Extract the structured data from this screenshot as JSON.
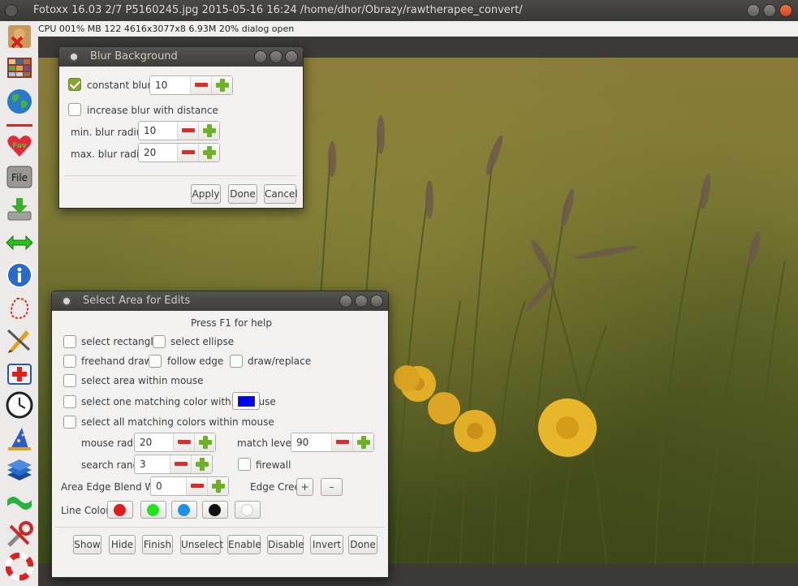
{
  "window": {
    "title": "Fotoxx 16.03  2/7  P5160245.jpg  2015-05-16 16:24  /home/dhor/Obrazy/rawtherapee_convert/"
  },
  "status": {
    "text": "CPU 001%  MB 122  4616x3077x8  6.93M  20%  dialog open"
  },
  "toolbar": {
    "file_label": "File",
    "fav_label": "Fav",
    "items": [
      "prev-next-image-icon",
      "thumbnail-gallery-icon",
      "globe-map-icon",
      "favorites-icon",
      "file-menu-icon",
      "save-icon",
      "zoom-icon",
      "info-icon",
      "select-area-icon",
      "edit-tools-icon",
      "repair-icon",
      "clock-icon",
      "art-effects-icon",
      "layers-icon",
      "warp-icon",
      "tools-icon",
      "help-icon"
    ]
  },
  "blur_dialog": {
    "title": "Blur Background",
    "constant_blur_label": "constant blur",
    "constant_blur_checked": true,
    "constant_blur_value": "10",
    "increase_label": "increase blur with distance",
    "increase_checked": false,
    "min_radius_label": "min. blur radius",
    "min_radius_value": "10",
    "max_radius_label": "max. blur radius",
    "max_radius_value": "20",
    "apply_label": "Apply",
    "done_label": "Done",
    "cancel_label": "Cancel"
  },
  "select_dialog": {
    "title": "Select Area for Edits",
    "help_text": "Press F1 for help",
    "select_rectangle": "select rectangle",
    "select_ellipse": "select ellipse",
    "freehand_draw": "freehand draw",
    "follow_edge": "follow edge",
    "draw_replace": "draw/replace",
    "select_within_mouse": "select area within mouse",
    "select_one_color": "select one matching color within mouse",
    "select_all_colors": "select all matching colors within mouse",
    "match_color": "#0000ff",
    "mouse_radius_label": "mouse radius",
    "mouse_radius_value": "20",
    "match_level_label": "match level %",
    "match_level_value": "90",
    "search_range_label": "search range",
    "search_range_value": "3",
    "firewall_label": "firewall",
    "edge_blend_label": "Area Edge Blend Width",
    "edge_blend_value": "0",
    "edge_creep_label": "Edge Creep",
    "edge_creep_plus": "+",
    "edge_creep_minus": "–",
    "line_color_label": "Line Color:",
    "line_colors": [
      "#e01b1b",
      "#1ee61e",
      "#1e90e6",
      "#111111",
      "#ffffff"
    ],
    "buttons": {
      "show": "Show",
      "hide": "Hide",
      "finish": "Finish",
      "unselect": "Unselect",
      "enable": "Enable",
      "disable": "Disable",
      "invert": "Invert",
      "done": "Done"
    }
  }
}
